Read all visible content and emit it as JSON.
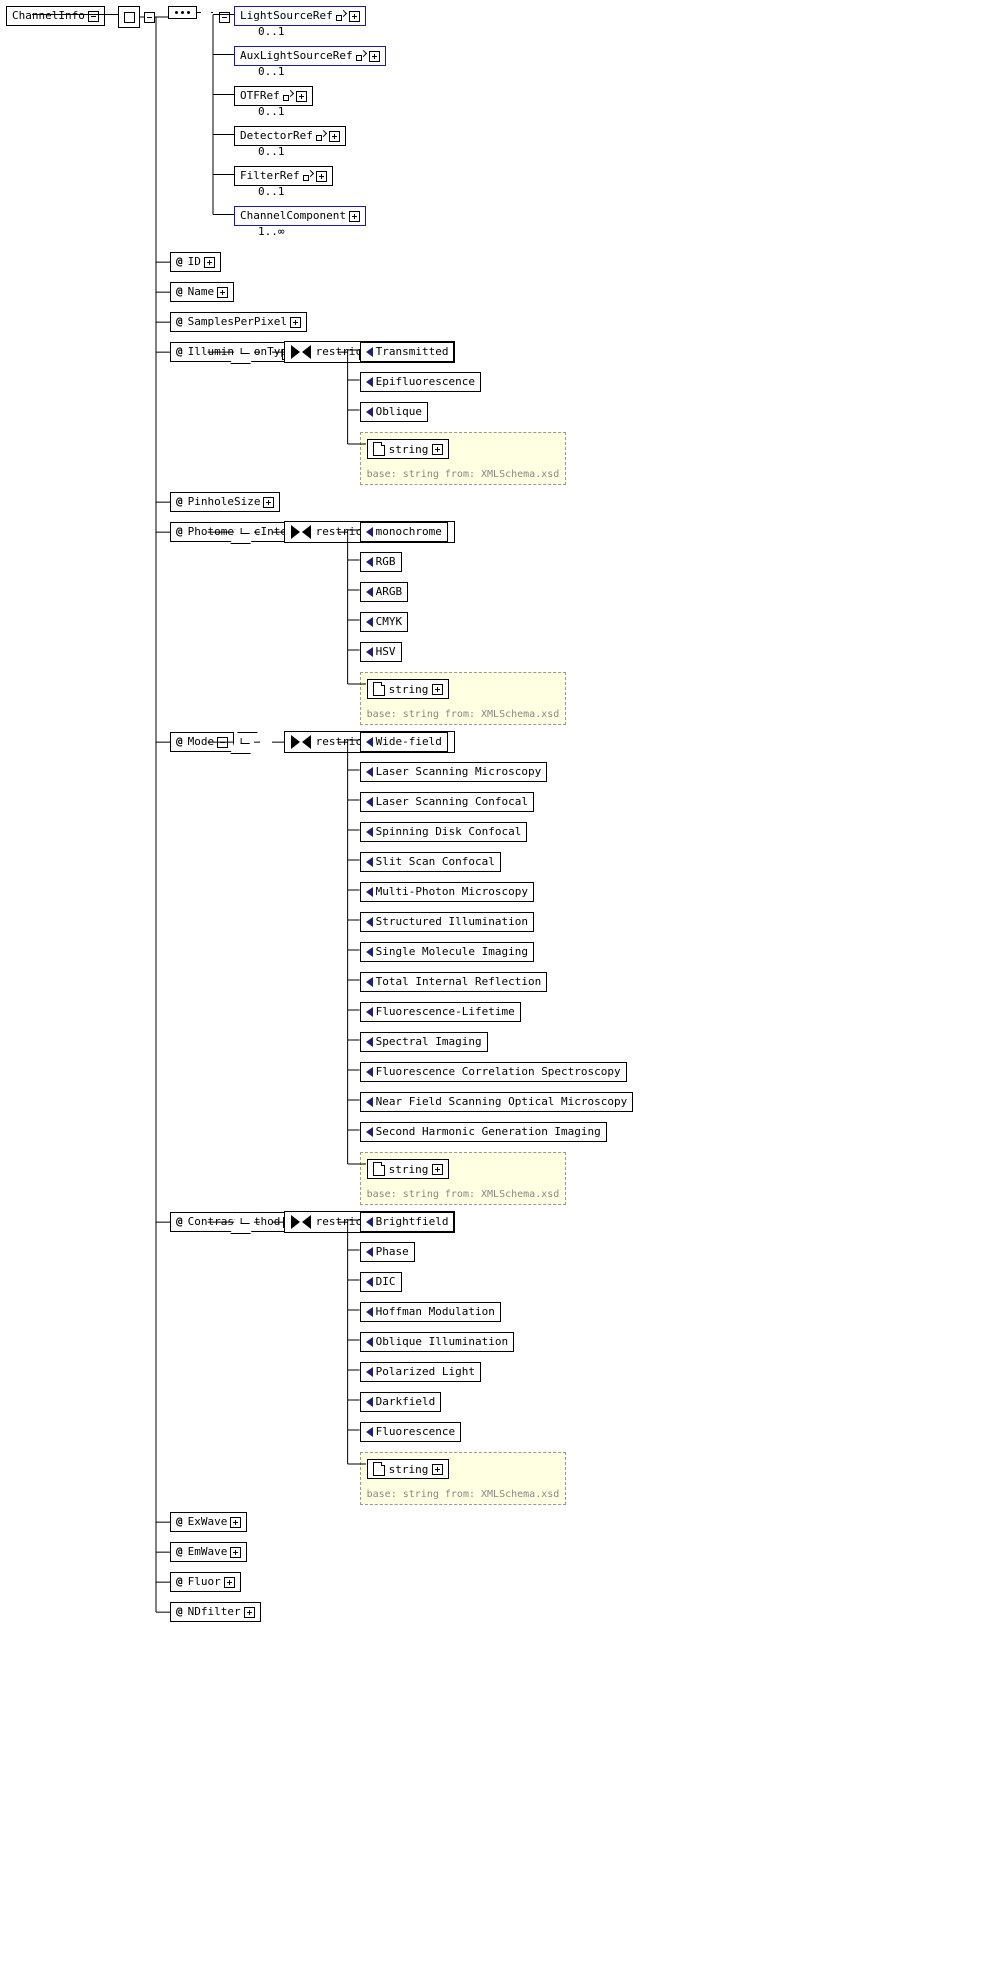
{
  "root": {
    "label": "ChannelInfo"
  },
  "seq_children": [
    {
      "label": "LightSourceRef",
      "card": "0..1",
      "blue": true,
      "link": true
    },
    {
      "label": "AuxLightSourceRef",
      "card": "0..1",
      "blue": true,
      "link": true
    },
    {
      "label": "OTFRef",
      "card": "0..1",
      "blue": false,
      "link": true
    },
    {
      "label": "DetectorRef",
      "card": "0..1",
      "blue": false,
      "link": true
    },
    {
      "label": "FilterRef",
      "card": "0..1",
      "blue": false,
      "link": true
    },
    {
      "label": "ChannelComponent",
      "card": "1..∞",
      "blue": true,
      "link": false
    }
  ],
  "restricts_label": "restricts: xs:string",
  "string_label": "string",
  "base_footer": "base: string from: XMLSchema.xsd",
  "attrs": {
    "id": "ID",
    "name": "Name",
    "samplesPerPixel": "SamplesPerPixel",
    "illuminationType": "IlluminationType",
    "pinholeSize": "PinholeSize",
    "photometricInterpretation": "PhotometricInterpretation",
    "mode": "Mode",
    "contrastMethod": "ContrastMethod",
    "exWave": "ExWave",
    "emWave": "EmWave",
    "fluor": "Fluor",
    "ndfilter": "NDfilter"
  },
  "enums": {
    "illuminationType": [
      "Transmitted",
      "Epifluorescence",
      "Oblique"
    ],
    "photometricInterpretation": [
      "monochrome",
      "RGB",
      "ARGB",
      "CMYK",
      "HSV"
    ],
    "mode": [
      "Wide-field",
      "Laser Scanning Microscopy",
      "Laser Scanning Confocal",
      "Spinning Disk Confocal",
      "Slit Scan Confocal",
      "Multi-Photon Microscopy",
      "Structured Illumination",
      "Single Molecule Imaging",
      "Total Internal Reflection",
      "Fluorescence-Lifetime",
      "Spectral Imaging",
      "Fluorescence Correlation Spectroscopy",
      "Near Field Scanning Optical Microscopy",
      "Second Harmonic Generation Imaging"
    ],
    "contrastMethod": [
      "Brightfield",
      "Phase",
      "DIC",
      "Hoffman Modulation",
      "Oblique Illumination",
      "Polarized Light",
      "Darkfield",
      "Fluorescence"
    ]
  }
}
